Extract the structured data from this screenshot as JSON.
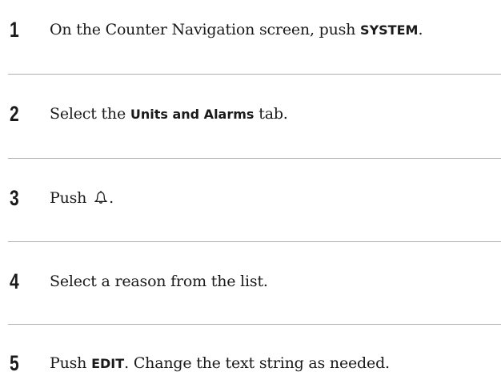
{
  "steps": [
    {
      "number": "1",
      "text_before": "On the Counter Navigation screen, push ",
      "term": "SYSTEM",
      "text_after": "."
    },
    {
      "number": "2",
      "text_before": "Select the ",
      "term": "Units and Alarms",
      "text_after": " tab."
    },
    {
      "number": "3",
      "text_before": "Push ",
      "icon": "bell-icon",
      "text_after": "."
    },
    {
      "number": "4",
      "text_before": "Select a reason from the list."
    },
    {
      "number": "5",
      "text_before": "Push ",
      "term": "EDIT",
      "text_after": ". Change the text string as needed."
    }
  ]
}
